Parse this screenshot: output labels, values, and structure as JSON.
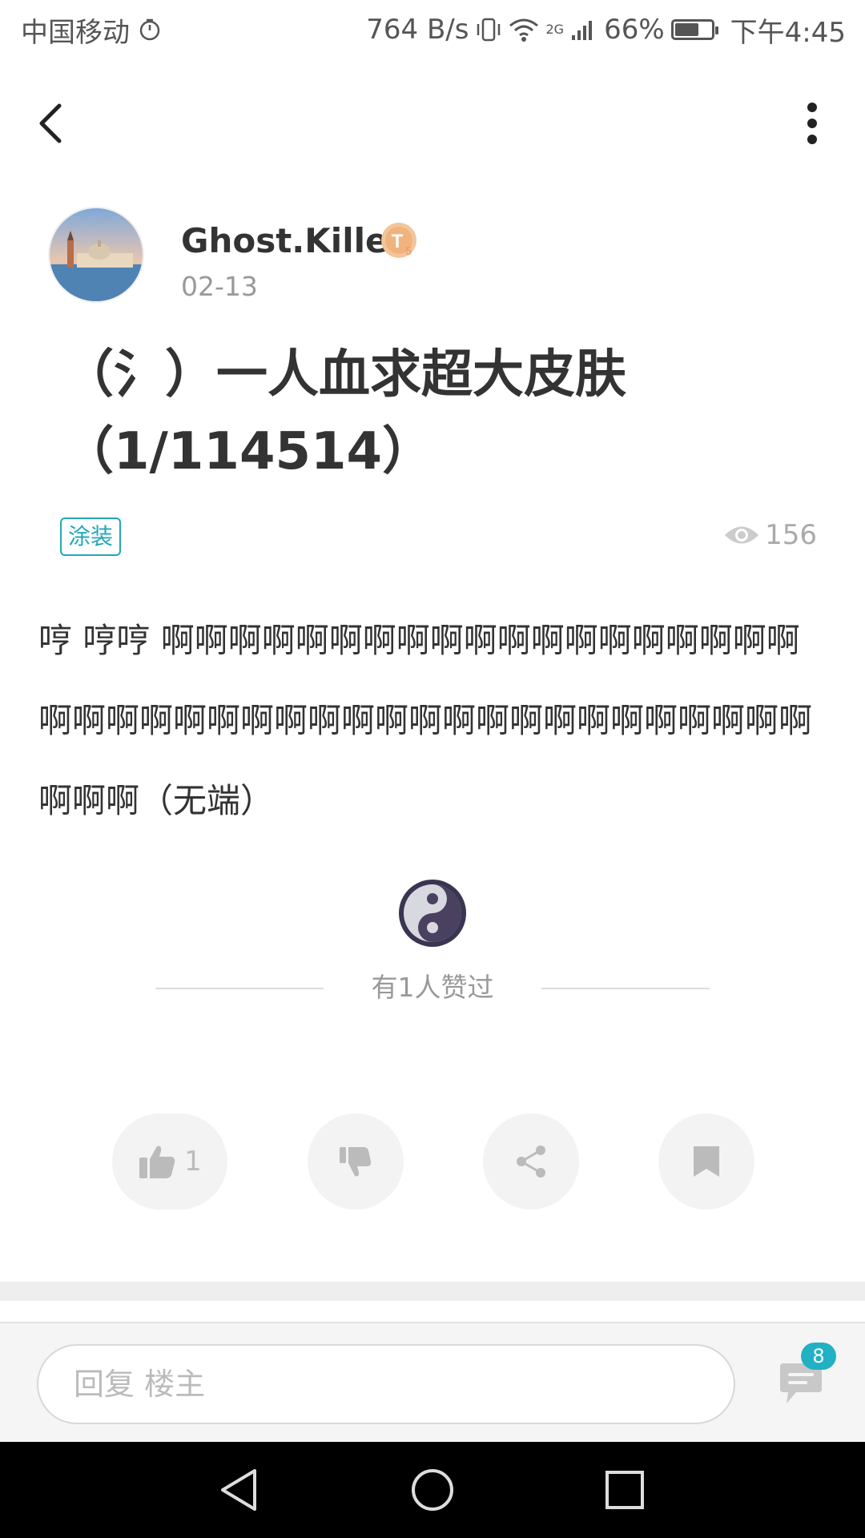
{
  "status_bar": {
    "carrier": "中国移动",
    "network_speed": "764 B/s",
    "signal_type": "2G",
    "battery": "66%",
    "battery_level": 0.66,
    "time": "下午4:45"
  },
  "app_bar": {
    "back_icon": "back-arrow-icon",
    "more_icon": "more-vertical-icon"
  },
  "post": {
    "author": {
      "name": "Ghost.Killer",
      "level_badge": "T5",
      "date": "02-13"
    },
    "title": "（氵）一人血求超大皮肤（1/114514）",
    "tag": "涂装",
    "views": "156",
    "body": "哼 哼哼  啊啊啊啊啊啊啊啊啊啊啊啊啊啊啊啊啊啊啊啊啊啊啊啊啊啊啊啊啊啊啊啊啊啊啊啊啊啊啊啊啊啊啊啊啊（无端）",
    "liked_by_text": "有1人赞过"
  },
  "actions": {
    "like_count": "1",
    "like_icon": "thumbs-up-icon",
    "dislike_icon": "thumbs-down-icon",
    "share_icon": "share-icon",
    "bookmark_icon": "bookmark-icon"
  },
  "reply_bar": {
    "placeholder": "回复  楼主",
    "comment_count": "8"
  },
  "colors": {
    "accent": "#22a8b8",
    "badge_gold": "#f0b37e",
    "muted": "#999999"
  }
}
